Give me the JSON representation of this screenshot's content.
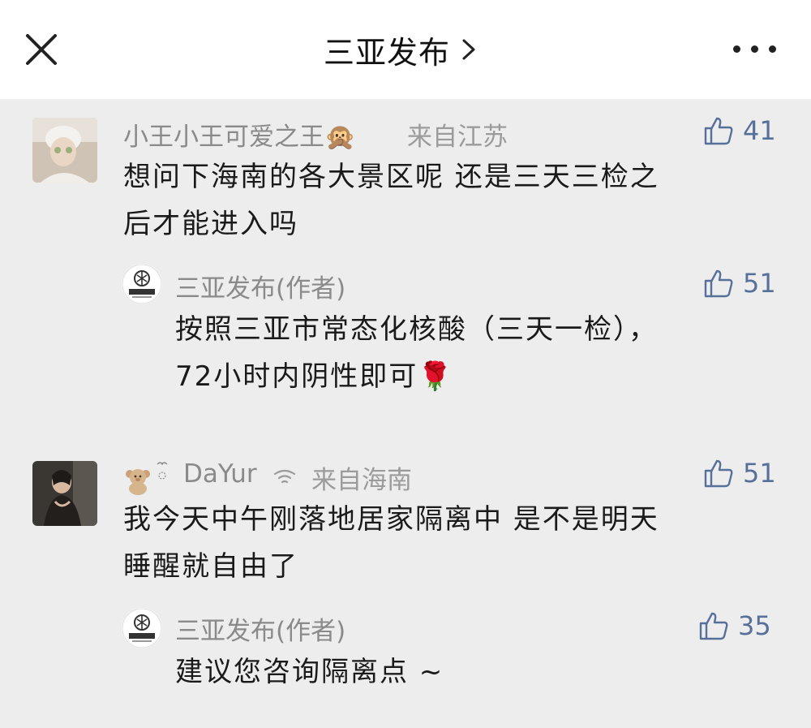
{
  "header": {
    "title": "三亚发布",
    "close_icon": "close-icon",
    "chevron_icon": "chevron-right-icon",
    "more_icon": "more-horizontal-icon"
  },
  "comments": [
    {
      "nickname": "小王小王可爱之王🙊",
      "location": "来自江苏",
      "likes": "41",
      "text_lines": [
        "想问下海南的各大景区呢  还是三天三检之",
        "后才能进入吗"
      ],
      "reply": {
        "nickname": "三亚发布(作者)",
        "likes": "51",
        "text_lines": [
          "按照三亚市常态化核酸（三天一检），",
          "72小时内阴性即可🌹"
        ]
      }
    },
    {
      "nickname": "DaYur",
      "location": "来自海南",
      "likes": "51",
      "text_lines": [
        "我今天中午刚落地居家隔离中  是不是明天",
        "睡醒就自由了"
      ],
      "reply": {
        "nickname": "三亚发布(作者)",
        "likes": "35",
        "text_lines": [
          "建议您咨询隔离点 ~"
        ]
      }
    }
  ],
  "colors": {
    "background": "#ededed",
    "header_bg": "#ffffff",
    "nickname": "#8a8a8a",
    "text": "#1a1a1a",
    "like": "#56709a"
  }
}
